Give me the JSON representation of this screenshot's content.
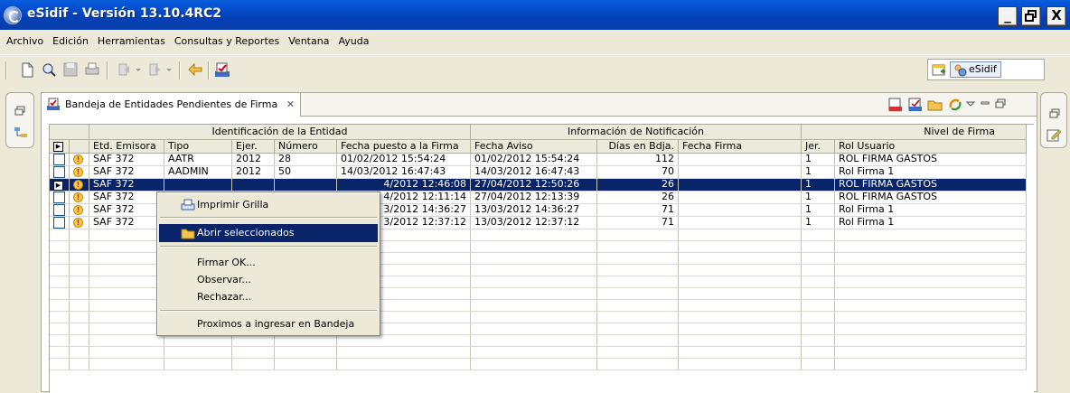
{
  "window": {
    "title": "eSidif - Versión 13.10.4RC2",
    "min": "_",
    "max": "▯",
    "close": "X"
  },
  "menu": [
    "Archivo",
    "Edición",
    "Herramientas",
    "Consultas y Reportes",
    "Ventana",
    "Ayuda"
  ],
  "toolbar": {
    "perspective_label": "eSidif"
  },
  "view": {
    "tab_title": "Bandeja de Entidades Pendientes de Firma",
    "tab_close": "✕"
  },
  "grid": {
    "groups": [
      "Identificación de la Entidad",
      "Información de Notificación",
      "Nivel de Firma"
    ],
    "columns": [
      "Etd. Emisora",
      "Tipo",
      "Ejer.",
      "Número",
      "Fecha puesto a la Firma",
      "Fecha Aviso",
      "Días en Bdja.",
      "Fecha Firma",
      "Jer.",
      "Rol Usuario"
    ],
    "rows": [
      {
        "emisora": "SAF 372",
        "tipo": "AATR",
        "ejer": "2012",
        "numero": "28",
        "fecha_firma_puesto": "01/02/2012 15:54:24",
        "fecha_aviso": "01/02/2012 15:54:24",
        "dias": "112",
        "fecha_firma": "",
        "jer": "1",
        "rol": "ROL FIRMA GASTOS"
      },
      {
        "emisora": "SAF 372",
        "tipo": "AADMIN",
        "ejer": "2012",
        "numero": "50",
        "fecha_firma_puesto": "14/03/2012 16:47:43",
        "fecha_aviso": "14/03/2012 16:47:43",
        "dias": "70",
        "fecha_firma": "",
        "jer": "1",
        "rol": "Rol Firma 1"
      },
      {
        "emisora": "SAF 372",
        "tipo": "",
        "ejer": "",
        "numero": "",
        "fecha_firma_puesto": "4/2012 12:46:08",
        "fecha_aviso": "27/04/2012 12:50:26",
        "dias": "26",
        "fecha_firma": "",
        "jer": "1",
        "rol": "ROL FIRMA GASTOS"
      },
      {
        "emisora": "SAF 372",
        "tipo": "",
        "ejer": "",
        "numero": "",
        "fecha_firma_puesto": "4/2012 12:11:14",
        "fecha_aviso": "27/04/2012 12:13:39",
        "dias": "26",
        "fecha_firma": "",
        "jer": "1",
        "rol": "ROL FIRMA GASTOS"
      },
      {
        "emisora": "SAF 372",
        "tipo": "",
        "ejer": "",
        "numero": "",
        "fecha_firma_puesto": "3/2012 14:36:27",
        "fecha_aviso": "13/03/2012 14:36:27",
        "dias": "71",
        "fecha_firma": "",
        "jer": "1",
        "rol": "Rol Firma 1"
      },
      {
        "emisora": "SAF 372",
        "tipo": "",
        "ejer": "",
        "numero": "",
        "fecha_firma_puesto": "3/2012 12:37:12",
        "fecha_aviso": "13/03/2012 12:37:12",
        "dias": "71",
        "fecha_firma": "",
        "jer": "1",
        "rol": "Rol Firma 1"
      }
    ],
    "selected_row": 2
  },
  "context_menu": {
    "items": [
      "Imprimir Grilla",
      "Abrir seleccionados",
      "Firmar OK...",
      "Observar...",
      "Rechazar...",
      "Proximos a ingresar en Bandeja"
    ],
    "highlighted": "Abrir seleccionados"
  }
}
